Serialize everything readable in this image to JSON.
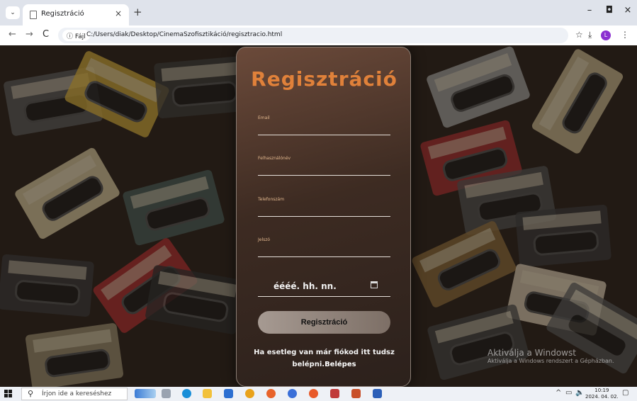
{
  "browser": {
    "tab_title": "Regisztráció",
    "tab_close": "×",
    "new_tab": "+",
    "menu_glyph": "⌄",
    "minimize": "–",
    "maximize": "◘",
    "close": "×",
    "back": "←",
    "forward": "→",
    "reload": "C",
    "info_chip": "ⓘ Fájl",
    "url": "C:/Users/diak/Desktop/CinemaSzofisztikáció/regisztracio.html",
    "bookmark_icon": "☆",
    "download_icon": "⤓",
    "profile_letter": "L",
    "more_icon": "⋮"
  },
  "form": {
    "title": "Regisztráció",
    "fields": [
      {
        "label": "Email",
        "value": ""
      },
      {
        "label": "Felhasználónév",
        "value": ""
      },
      {
        "label": "Telefonszám",
        "value": ""
      },
      {
        "label": "Jelszó",
        "value": ""
      }
    ],
    "date_placeholder": "éééé. hh. nn.",
    "submit_label": "Regisztráció",
    "footer_text": "Ha esetleg van már fiókod itt tudsz belépni.",
    "login_link": "Belépes"
  },
  "watermark": {
    "title": "Aktiválja a Windowst",
    "subtitle": "Aktiválja a Windows rendszert a Gépházban."
  },
  "taskbar": {
    "search_placeholder": "Írjon ide a kereséshez",
    "search_icon": "⚲",
    "time": "10:19",
    "date": "2024. 04. 02.",
    "tray_icons": [
      "^",
      "▭",
      "🔈"
    ],
    "notification_icon": "▢"
  },
  "colors": {
    "title_accent": "#e0813a",
    "card_bg": "#3d2b22",
    "button_bg": "#a69a92"
  }
}
